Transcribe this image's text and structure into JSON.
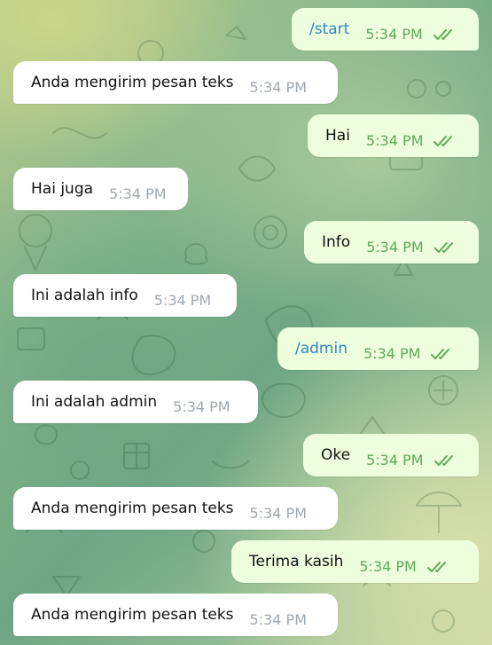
{
  "colors": {
    "incoming_bubble": "#ffffff",
    "outgoing_bubble": "#eeffde",
    "command_text": "#2e86c7",
    "outgoing_time": "#60a85a",
    "incoming_time": "#a0a8b0"
  },
  "icons": {
    "read_status": "double-check-icon"
  },
  "messages": [
    {
      "dir": "out",
      "text": "/start",
      "time": "5:34 PM",
      "command": true
    },
    {
      "dir": "in",
      "text": "Anda mengirim pesan teks",
      "time": "5:34 PM"
    },
    {
      "dir": "out",
      "text": "Hai",
      "time": "5:34 PM"
    },
    {
      "dir": "in",
      "text": "Hai juga",
      "time": "5:34 PM"
    },
    {
      "dir": "out",
      "text": "Info",
      "time": "5:34 PM"
    },
    {
      "dir": "in",
      "text": "Ini adalah info",
      "time": "5:34 PM"
    },
    {
      "dir": "out",
      "text": "/admin",
      "time": "5:34 PM",
      "command": true
    },
    {
      "dir": "in",
      "text": "Ini adalah admin",
      "time": "5:34 PM"
    },
    {
      "dir": "out",
      "text": "Oke",
      "time": "5:34 PM"
    },
    {
      "dir": "in",
      "text": "Anda mengirim pesan teks",
      "time": "5:34 PM"
    },
    {
      "dir": "out",
      "text": "Terima kasih",
      "time": "5:34 PM"
    },
    {
      "dir": "in",
      "text": "Anda mengirim pesan teks",
      "time": "5:34 PM"
    }
  ]
}
